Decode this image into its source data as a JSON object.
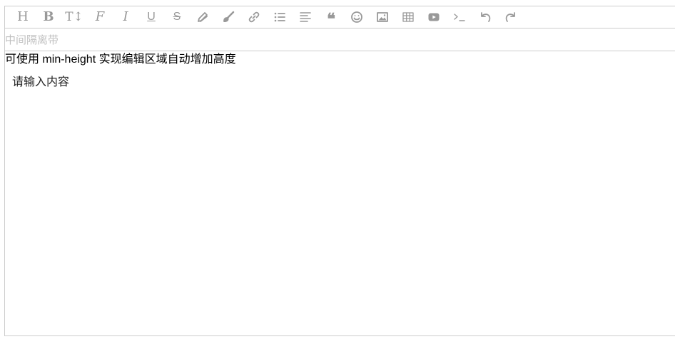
{
  "toolbar": {
    "items": [
      {
        "name": "header-icon",
        "glyph": "H"
      },
      {
        "name": "bold-icon",
        "glyph": "B"
      },
      {
        "name": "font-size-icon",
        "glyph": "T↕"
      },
      {
        "name": "font-family-icon",
        "glyph": "F"
      },
      {
        "name": "italic-icon",
        "glyph": "I"
      },
      {
        "name": "underline-icon",
        "glyph": "U"
      },
      {
        "name": "strikethrough-icon",
        "glyph": "S"
      },
      {
        "name": "pencil-icon"
      },
      {
        "name": "brush-icon"
      },
      {
        "name": "link-icon"
      },
      {
        "name": "list-icon"
      },
      {
        "name": "align-icon"
      },
      {
        "name": "quote-icon",
        "glyph": "❝"
      },
      {
        "name": "emoticon-icon"
      },
      {
        "name": "image-icon"
      },
      {
        "name": "table-icon"
      },
      {
        "name": "video-icon"
      },
      {
        "name": "code-icon"
      },
      {
        "name": "undo-icon"
      },
      {
        "name": "redo-icon"
      }
    ]
  },
  "divider": {
    "label": "中间隔离带"
  },
  "editor": {
    "hint": "可使用 min-height 实现编辑区域自动增加高度",
    "placeholder": "请输入内容"
  }
}
